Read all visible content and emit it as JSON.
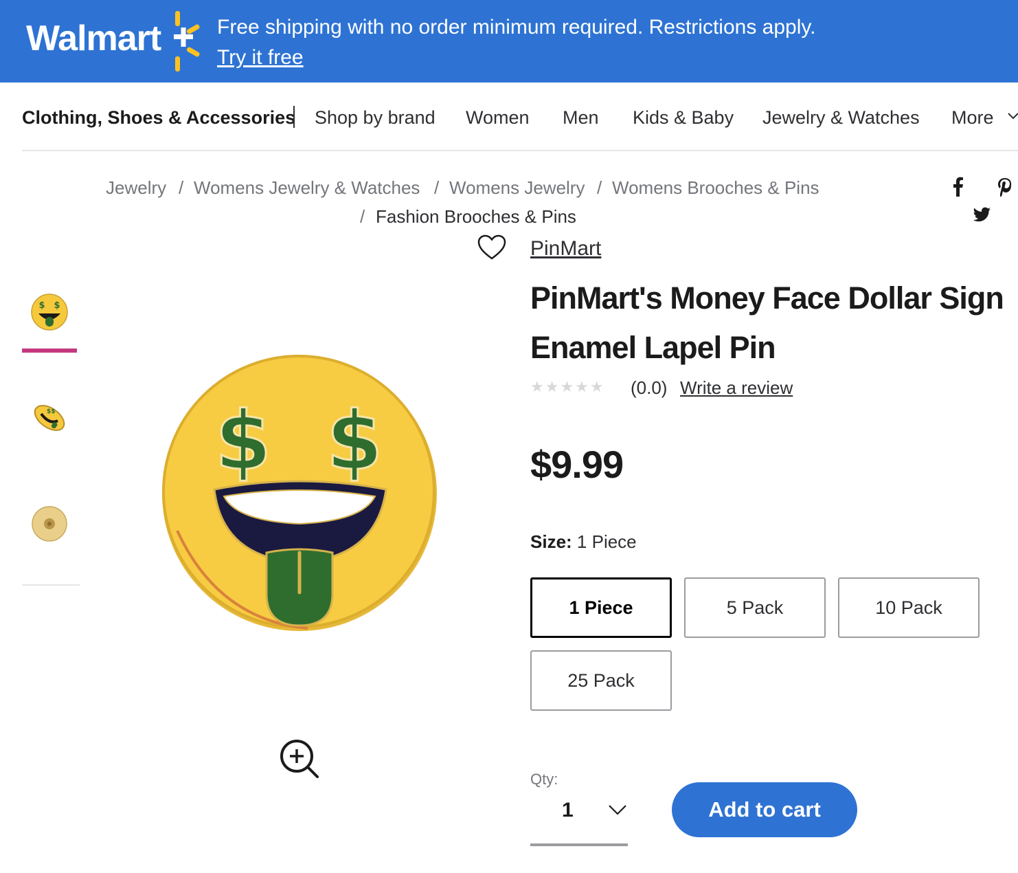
{
  "banner": {
    "brand": "Walmart+",
    "logo_text": "Walmart",
    "promo_text": "Free shipping with no order minimum required. Restrictions apply.",
    "cta_label": "Try it free",
    "background_color": "#2e73d3",
    "spark_color": "#ffc220"
  },
  "category_nav": {
    "main": "Clothing, Shoes & Accessories",
    "items": [
      "Shop by brand",
      "Women",
      "Men",
      "Kids & Baby",
      "Jewelry & Watches",
      "More"
    ]
  },
  "breadcrumb": {
    "items": [
      "Jewelry",
      "Womens Jewelry & Watches",
      "Womens Jewelry",
      "Womens Brooches & Pins",
      "Fashion Brooches & Pins"
    ],
    "separator": "/"
  },
  "social": {
    "icons": [
      "facebook-icon",
      "pinterest-icon",
      "twitter-icon"
    ]
  },
  "gallery": {
    "thumbnails": [
      "money-face-pin-front",
      "money-face-pin-angle",
      "money-face-pin-back"
    ],
    "selected_index": 0,
    "indicator_color": "#c4387f"
  },
  "product": {
    "brand": "PinMart",
    "title": "PinMart's Money Face Dollar Sign Enamel Lapel Pin",
    "rating_value": 0,
    "rating_text": "(0.0)",
    "write_review": "Write a review",
    "price": "$9.99",
    "size_label": "Size:",
    "size_selected": "1 Piece",
    "size_options": [
      "1 Piece",
      "5 Pack",
      "10 Pack",
      "25 Pack"
    ],
    "qty_label": "Qty:",
    "qty_value": "1",
    "add_to_cart": "Add to cart"
  }
}
